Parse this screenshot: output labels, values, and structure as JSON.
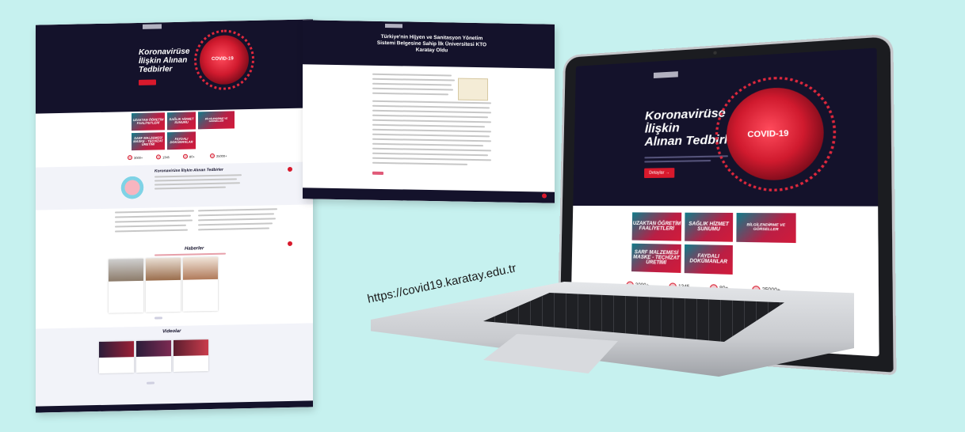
{
  "url_caption": "https://covid19.karatay.edu.tr",
  "left_page": {
    "hero_title": "Koronavirüse İlişkin Alınan Tedbirler",
    "covid_label": "COVID-19",
    "tiles": [
      "UZAKTAN ÖĞRETİM FAALİYETLERİ",
      "SAĞLIK HİZMET SUNUMU",
      "BİLGİLENDİRME VE GÖRSELLER",
      "SARF MALZEMESİ MASKE - TEÇHİZAT ÜRETİMİ",
      "FAYDALI DOKÜMANLAR"
    ],
    "section_title": "Koronavirüse İlişkin Alınan Tedbirler",
    "news_title": "Haberler",
    "videos_title": "Videolar",
    "stats": [
      "3000+",
      "1345",
      "80+",
      "25000+"
    ]
  },
  "middle_page": {
    "title": "Türkiye'nin Hijyen ve Sanitasyon Yönetim Sistemi Belgesine Sahip İlk Üniversitesi KTO Karatay Oldu"
  },
  "laptop": {
    "hero_title_1": "Koronavirüse",
    "hero_title_2": "İlişkin",
    "hero_title_3": "Alınan Tedbirler",
    "covid_label": "COVID-19",
    "button_label": "Detaylar →",
    "tiles": [
      "UZAKTAN ÖĞRETİM FAALİYETLERİ",
      "SAĞLIK HİZMET SUNUMU",
      "BİLGİLENDİRME VE GÖRSELLER",
      "SARF MALZEMESİ MASKE - TEÇHİZAT ÜRETİMİ",
      "FAYDALI DOKÜMANLAR"
    ],
    "stats": [
      "3000+",
      "1345",
      "80+",
      "25000+"
    ]
  }
}
